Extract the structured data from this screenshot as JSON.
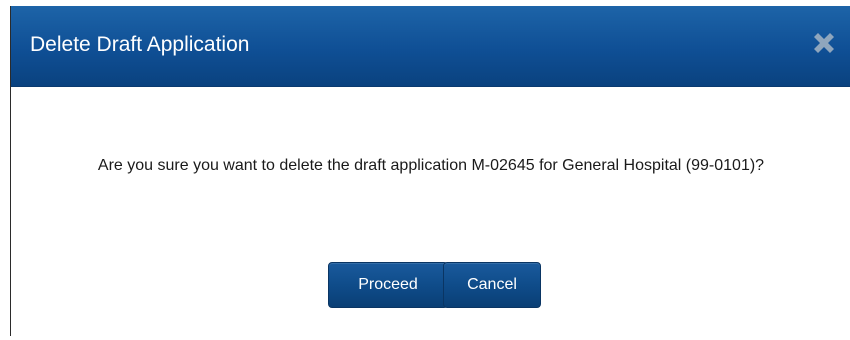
{
  "dialog": {
    "title": "Delete Draft Application",
    "close_icon": "close-icon",
    "message": "Are you sure you want to delete the draft application M-02645 for General Hospital (99-0101)?",
    "buttons": {
      "proceed_label": "Proceed",
      "cancel_label": "Cancel"
    }
  },
  "colors": {
    "header_background": "#0f4f95",
    "button_background": "#0f4c8a",
    "close_icon": "#8fa6bd",
    "text": "#1a1a1a"
  }
}
